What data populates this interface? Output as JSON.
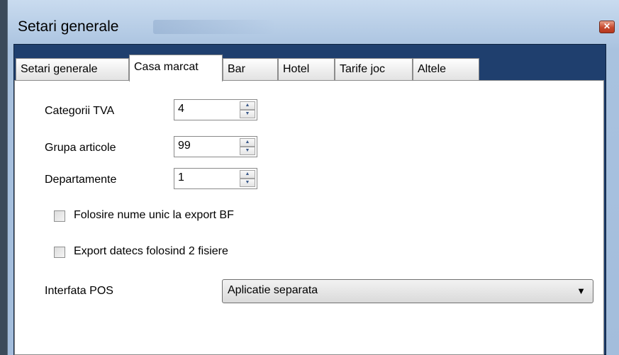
{
  "window": {
    "title": "Setari generale",
    "close_glyph": "✕"
  },
  "tabs": [
    {
      "label": "Setari generale"
    },
    {
      "label": "Casa marcat"
    },
    {
      "label": "Bar"
    },
    {
      "label": "Hotel"
    },
    {
      "label": "Tarife joc"
    },
    {
      "label": "Altele"
    }
  ],
  "active_tab": "Casa marcat",
  "fields": {
    "categorii_tva": {
      "label": "Categorii TVA",
      "value": "4"
    },
    "grupa_articole": {
      "label": "Grupa articole",
      "value": "99"
    },
    "departamente": {
      "label": "Departamente",
      "value": "1"
    }
  },
  "checkboxes": {
    "nume_unic": {
      "label": "Folosire nume unic la export BF",
      "checked": false
    },
    "export_datecs": {
      "label": "Export datecs folosind 2 fisiere",
      "checked": false
    }
  },
  "interfata_pos": {
    "label": "Interfata POS",
    "selected": "Aplicatie separata"
  },
  "icons": {
    "spin_up": "▲",
    "spin_down": "▼",
    "dropdown": "▼"
  }
}
